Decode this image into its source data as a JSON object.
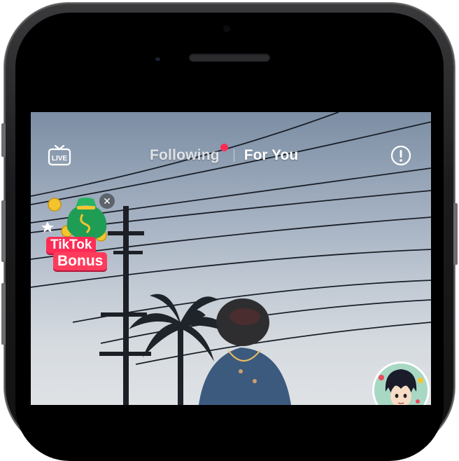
{
  "topbar": {
    "live_label": "LIVE",
    "tabs": [
      {
        "label": "Following",
        "has_notification": true
      },
      {
        "label": "For You",
        "active": true
      }
    ]
  },
  "bonus": {
    "line1": "TikTok",
    "line2": "Bonus",
    "close_glyph": "✕"
  },
  "colors": {
    "accent": "#fe2c55"
  }
}
